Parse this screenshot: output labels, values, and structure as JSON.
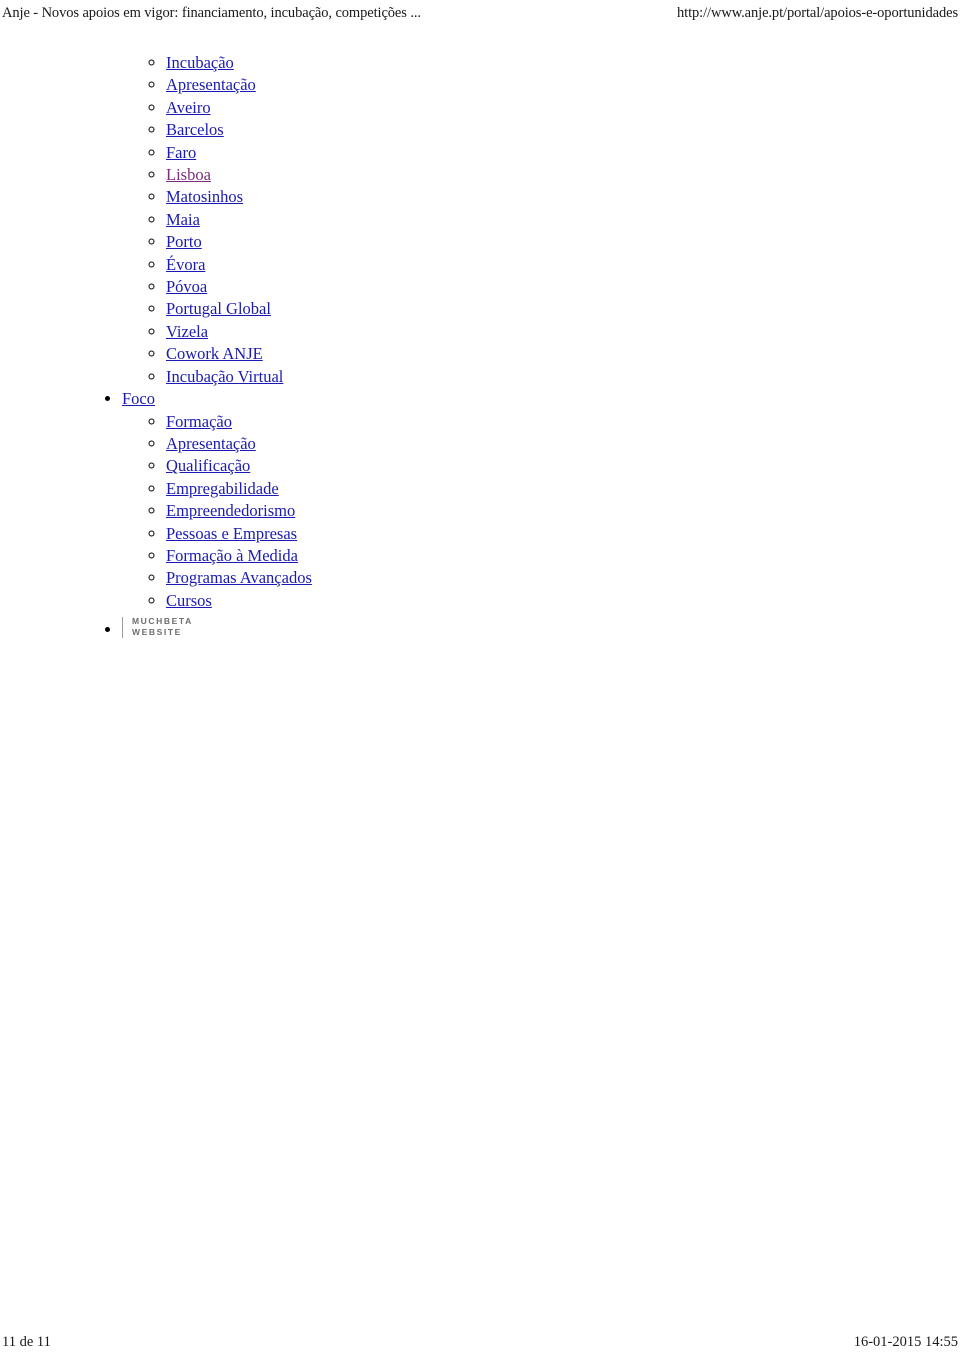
{
  "header": {
    "title": "Anje - Novos apoios em vigor: financiamento, incubação, competições ...",
    "url": "http://www.anje.pt/portal/apoios-e-oportunidades"
  },
  "nav": {
    "groups": [
      {
        "label": null,
        "has_marker": false,
        "items": [
          {
            "label": "Incubação",
            "state": "link"
          },
          {
            "label": "Apresentação",
            "state": "link"
          },
          {
            "label": "Aveiro",
            "state": "link"
          },
          {
            "label": "Barcelos",
            "state": "link"
          },
          {
            "label": "Faro",
            "state": "link"
          },
          {
            "label": "Lisboa",
            "state": "visited"
          },
          {
            "label": "Matosinhos",
            "state": "link"
          },
          {
            "label": "Maia",
            "state": "link"
          },
          {
            "label": "Porto",
            "state": "link"
          },
          {
            "label": "Évora",
            "state": "link"
          },
          {
            "label": "Póvoa",
            "state": "link"
          },
          {
            "label": "Portugal Global",
            "state": "link"
          },
          {
            "label": "Vizela",
            "state": "link"
          },
          {
            "label": "Cowork ANJE",
            "state": "link"
          },
          {
            "label": "Incubação Virtual",
            "state": "link"
          }
        ]
      },
      {
        "label": "Foco",
        "has_marker": true,
        "items": [
          {
            "label": "Formação",
            "state": "link"
          },
          {
            "label": "Apresentação",
            "state": "link"
          },
          {
            "label": "Qualificação",
            "state": "link"
          },
          {
            "label": "Empregabilidade",
            "state": "link"
          },
          {
            "label": "Empreendedorismo",
            "state": "link"
          },
          {
            "label": "Pessoas e Empresas",
            "state": "link"
          },
          {
            "label": "Formação à Medida",
            "state": "link"
          },
          {
            "label": "Programas Avançados",
            "state": "link"
          },
          {
            "label": "Cursos",
            "state": "link"
          }
        ]
      }
    ]
  },
  "logo": {
    "line1": "MUCHBETA",
    "line2": "WEBSITE"
  },
  "footer": {
    "page": "11 de 11",
    "timestamp": "16-01-2015 14:55"
  },
  "colors": {
    "link": "#1b1bb3",
    "visited": "#7b2d7b",
    "text": "#1a1a1a",
    "logo_text": "#6d6d6d",
    "background": "#ffffff"
  }
}
